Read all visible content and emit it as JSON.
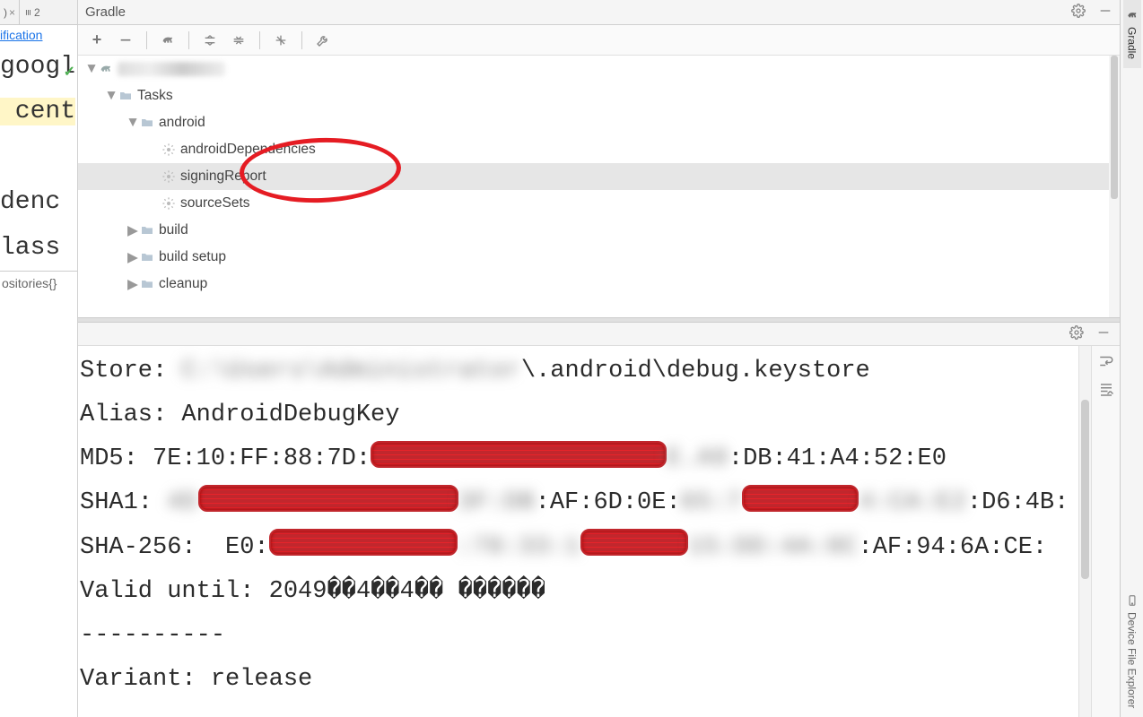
{
  "leftStrip": {
    "tab1_label": ")",
    "tab2_icon": "≡",
    "tab2_label": "2",
    "verification_link": "ification",
    "code_line1": "googl",
    "code_line2": " cent",
    "code_line3": "",
    "code_line4": "denc",
    "code_line5": "lass",
    "bottom_label": "ositories{}"
  },
  "gradlePanel": {
    "title": "Gradle",
    "toolbar": {
      "plus": "+",
      "minus": "−"
    }
  },
  "tree": {
    "root": {
      "label_blurred": true
    },
    "tasks_label": "Tasks",
    "android_label": "android",
    "androidDeps_label": "androidDependencies",
    "signingReport_label": "signingReport",
    "sourceSets_label": "sourceSets",
    "build_label": "build",
    "buildSetup_label": "build setup",
    "cleanup_label": "cleanup"
  },
  "console": {
    "store_label": "Store: ",
    "store_blur": "C:\\Users\\Administrator",
    "store_rest": "\\.android\\debug.keystore",
    "alias_line": "Alias: AndroidDebugKey",
    "md5_prefix": "MD5: 7E:10:FF:88:7D:",
    "md5_blur": "E.A9",
    "md5_suffix": ":DB:41:A4:52:E0",
    "sha1_prefix": "SHA1: ",
    "sha1_blur1": "4D",
    "sha1_blur2": "3F:DB",
    "sha1_mid": ":AF:6D:0E:",
    "sha1_blur3": "65:7",
    "sha1_blur4": "4:CA:E2",
    "sha1_suffix": ":D6:4B:",
    "sha256_prefix": "SHA-256:  E0:",
    "sha256_blur1": ":78:33:1",
    "sha256_blur2": "15:DD:4A:0C",
    "sha256_suffix": ":AF:94:6A:CE:",
    "valid_line": "Valid until: 2049��4��4�� ������",
    "sep_line": "----------",
    "variant_line": "Variant: release"
  },
  "rightBar": {
    "gradle_tab": "Gradle",
    "device_tab": "Device File Explorer"
  }
}
